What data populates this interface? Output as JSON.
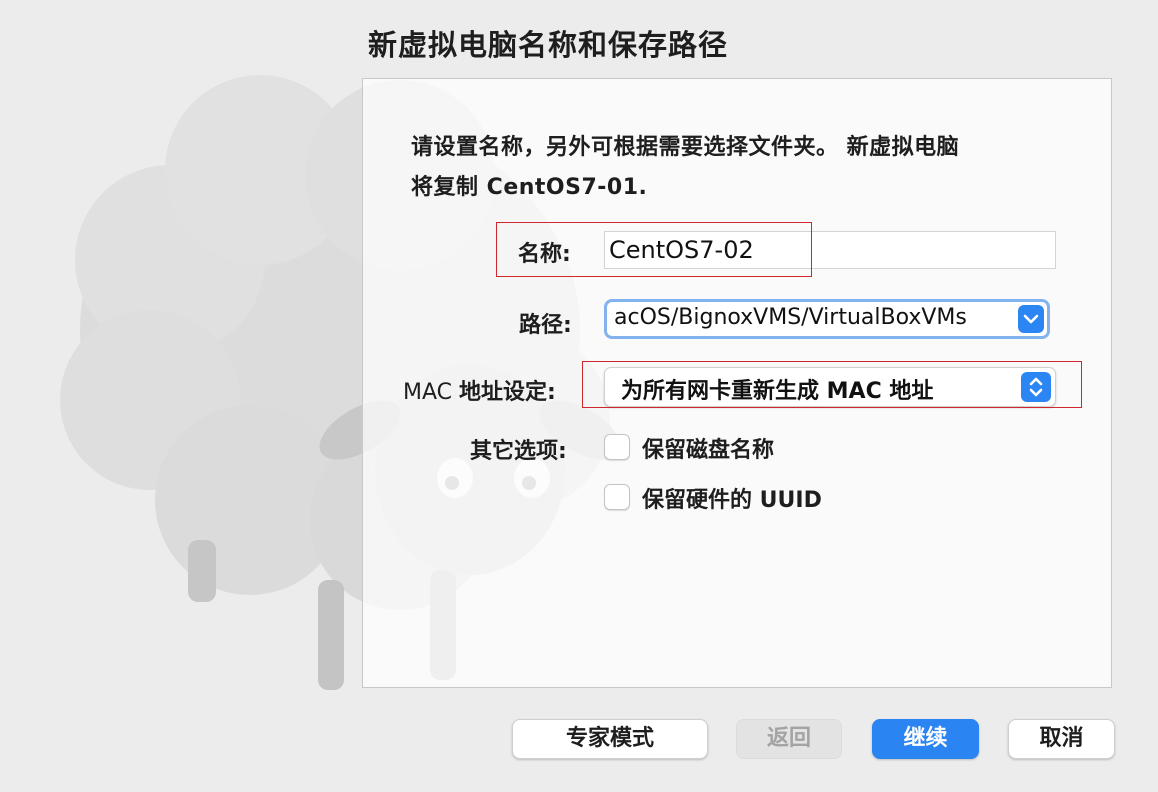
{
  "window": {
    "title": "新虚拟电脑名称和保存路径"
  },
  "description": {
    "line1": "请设置名称，另外可根据需要选择文件夹。 新虚拟电脑",
    "line2_prefix": "将复制 ",
    "line2_bold": "CentOS7-01",
    "line2_suffix": "."
  },
  "form": {
    "name_label": "名称:",
    "name_value": "CentOS7-02",
    "path_label": "路径:",
    "path_value": "acOS/BignoxVMS/VirtualBoxVMs",
    "mac_label_latin": "MAC ",
    "mac_label_cjk": "地址设定:",
    "mac_value": "为所有网卡重新生成 MAC 地址",
    "other_label": "其它选项:",
    "checkbox_keep_disk_names": "保留磁盘名称",
    "checkbox_keep_hw_uuid": "保留硬件的 UUID"
  },
  "buttons": {
    "expert": "专家模式",
    "back": "返回",
    "continue": "继续",
    "cancel": "取消"
  },
  "icons": {
    "path_dropdown": "chevron-down-icon",
    "mac_dropdown": "up-down-chevron-icon",
    "background": "sheep-illustration"
  },
  "colors": {
    "accent": "#2a84f2",
    "highlight_box": "#d0262f"
  }
}
